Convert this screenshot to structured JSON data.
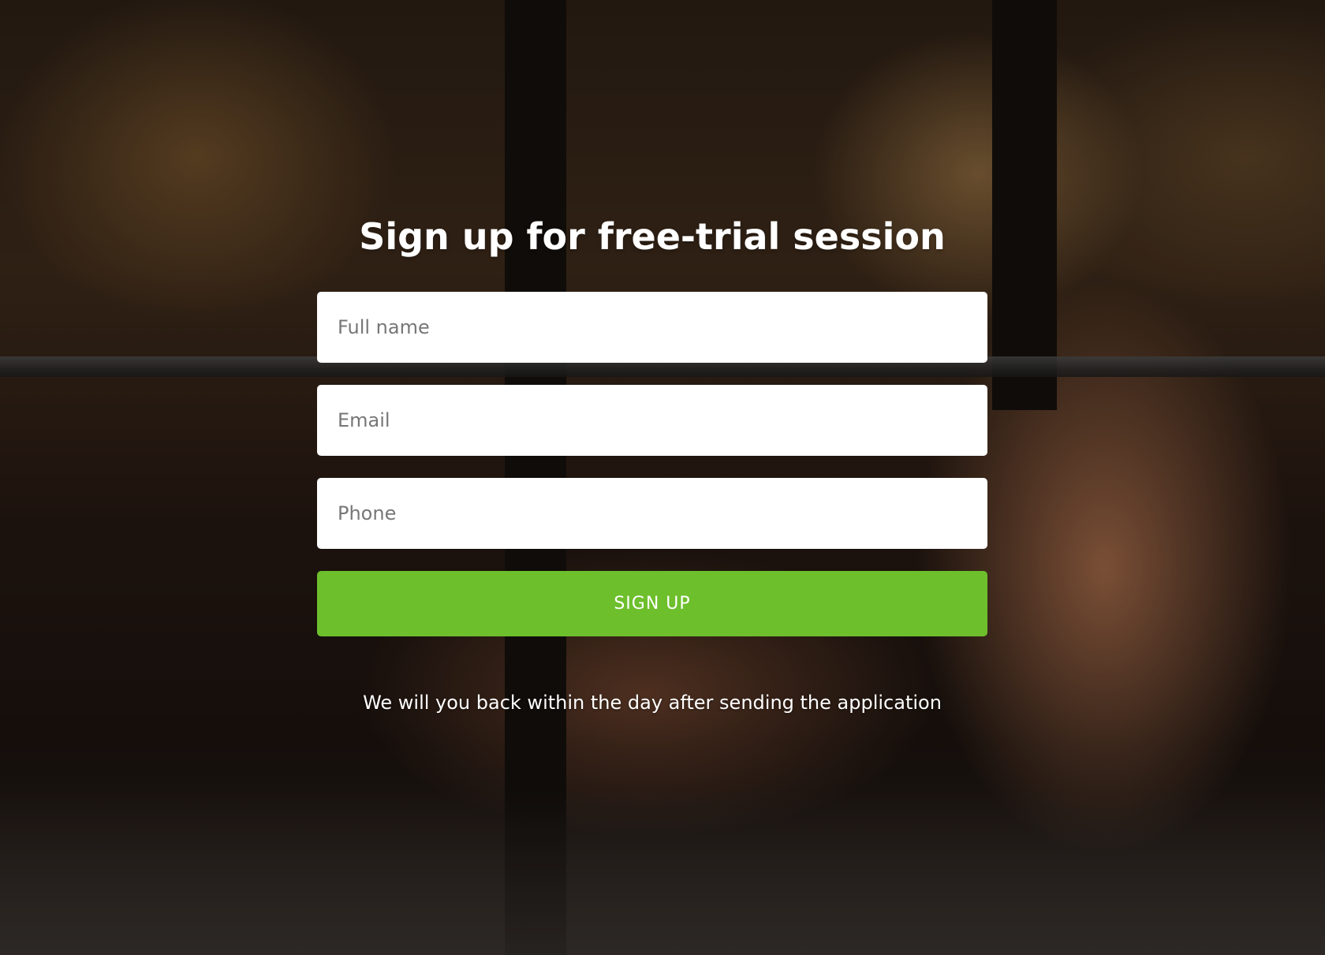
{
  "hero": {
    "background_image": "gym-weightlifting-woman-photo",
    "title": "Sign up for free-trial session"
  },
  "form": {
    "full_name": {
      "placeholder": "Full name",
      "value": ""
    },
    "email": {
      "placeholder": "Email",
      "value": ""
    },
    "phone": {
      "placeholder": "Phone",
      "value": ""
    },
    "submit_label": "SIGN UP",
    "note": "We will you back within the day after sending the application"
  },
  "colors": {
    "accent": "#6dbf2c",
    "field_background": "#ffffff",
    "title_text": "#ffffff"
  }
}
